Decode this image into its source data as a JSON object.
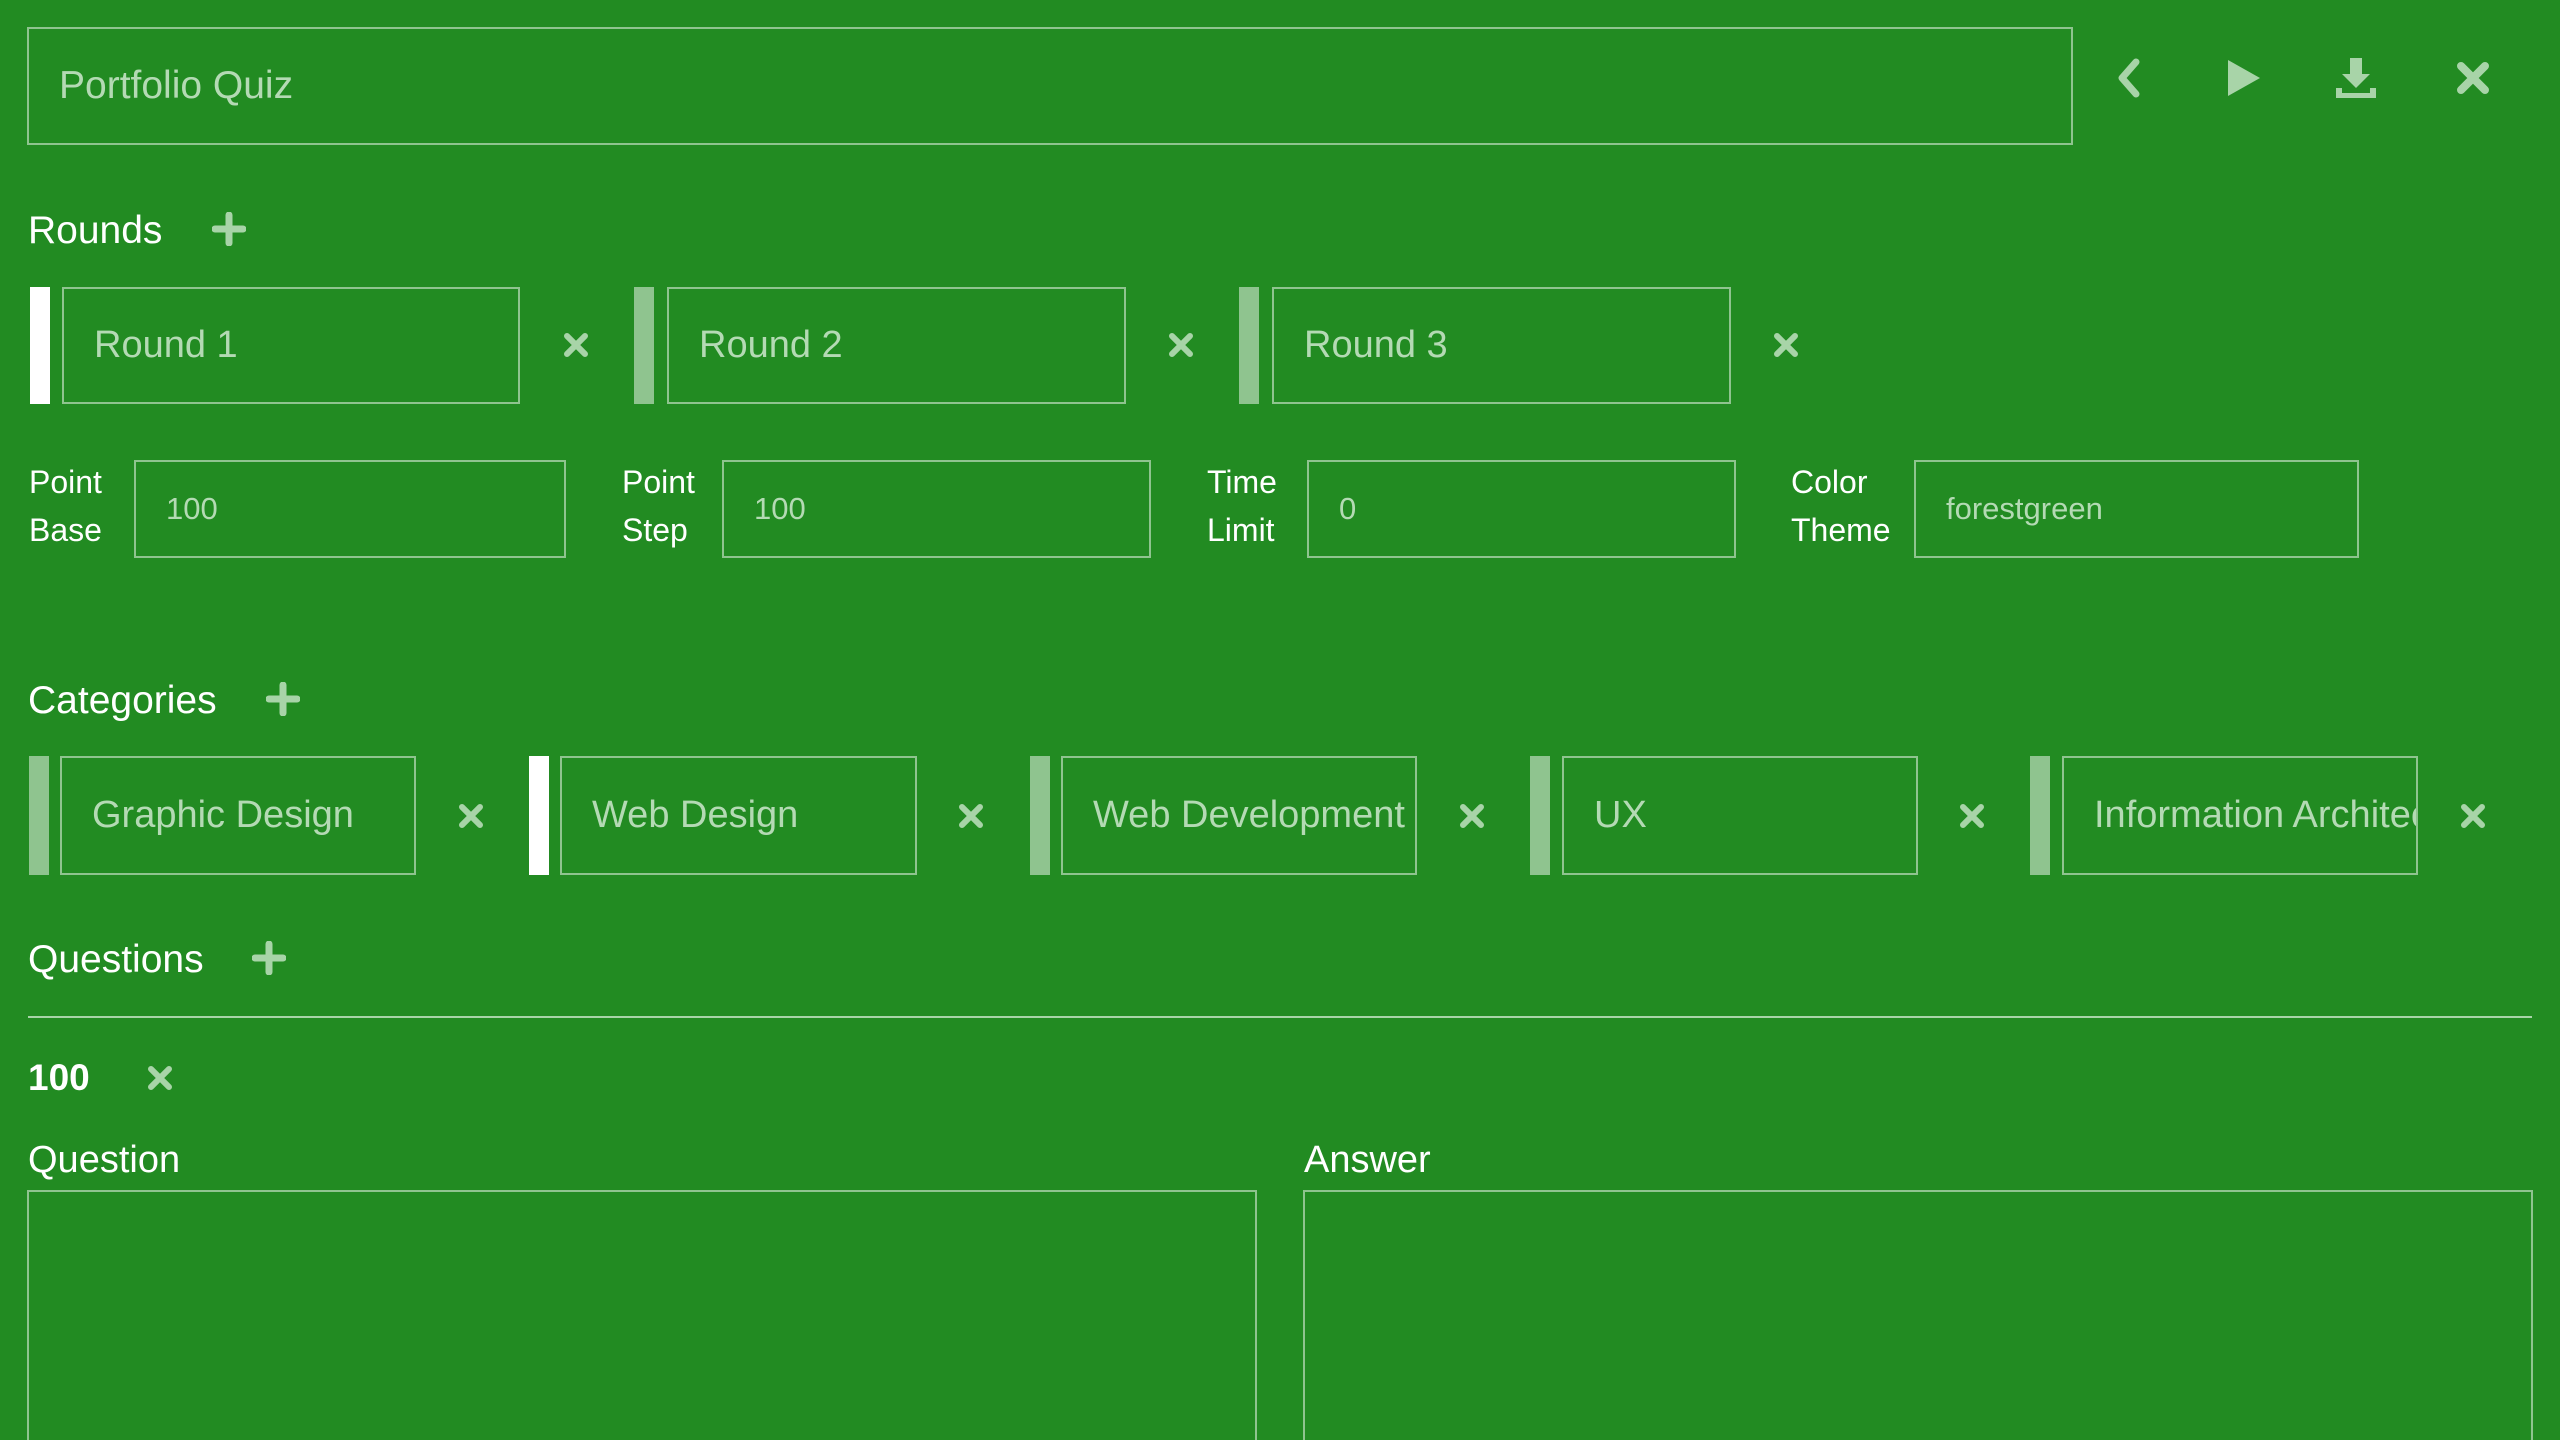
{
  "quiz": {
    "title_value": "Portfolio Quiz"
  },
  "toolbar": {
    "back_icon": "chevron-left-icon",
    "play_icon": "play-icon",
    "download_icon": "download-icon",
    "close_icon": "close-icon"
  },
  "rounds": {
    "heading": "Rounds",
    "add_icon": "plus-icon",
    "items": [
      {
        "value": "Round 1",
        "active": true
      },
      {
        "value": "Round 2",
        "active": false
      },
      {
        "value": "Round 3",
        "active": false
      }
    ]
  },
  "settings": {
    "point_base": {
      "label_line1": "Point",
      "label_line2": "Base",
      "value": "100"
    },
    "point_step": {
      "label_line1": "Point",
      "label_line2": "Step",
      "value": "100"
    },
    "time_limit": {
      "label_line1": "Time",
      "label_line2": "Limit",
      "value": "0"
    },
    "color_theme": {
      "label_line1": "Color",
      "label_line2": "Theme",
      "value": "forestgreen"
    }
  },
  "categories": {
    "heading": "Categories",
    "add_icon": "plus-icon",
    "items": [
      {
        "value": "Graphic Design",
        "active": false
      },
      {
        "value": "Web Design",
        "active": true
      },
      {
        "value": "Web Development",
        "active": false
      },
      {
        "value": "UX",
        "active": false
      },
      {
        "value": "Information Architecture",
        "active": false
      }
    ]
  },
  "questions": {
    "heading": "Questions",
    "add_icon": "plus-icon",
    "current": {
      "points": "100",
      "question_label": "Question",
      "answer_label": "Answer",
      "question_value": "",
      "answer_value": ""
    }
  },
  "colors": {
    "background": "#228b22",
    "border": "#8fc48f",
    "input_text": "#b4dab4",
    "active_bar": "#ffffff",
    "inactive_bar": "#8fc48f"
  }
}
